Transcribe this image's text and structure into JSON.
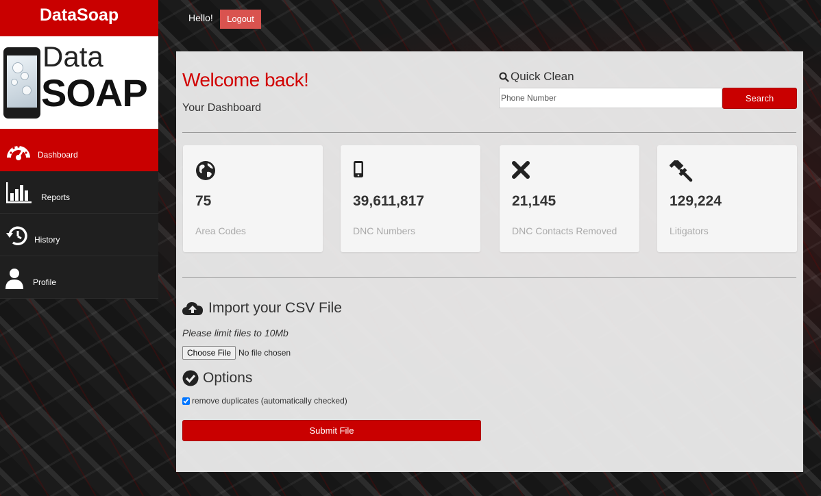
{
  "app": {
    "brand": "DataSoap",
    "logo_line1": "Data",
    "logo_line2": "SOAP",
    "accent_color": "#c90000"
  },
  "sidebar": {
    "items": [
      {
        "label": "Dashboard",
        "icon": "dashboard-gauge-icon",
        "active": true
      },
      {
        "label": "Reports",
        "icon": "bar-chart-icon",
        "active": false
      },
      {
        "label": "History",
        "icon": "history-icon",
        "active": false
      },
      {
        "label": "Profile",
        "icon": "user-icon",
        "active": false
      }
    ]
  },
  "topbar": {
    "greeting": "Hello!",
    "logout_label": "Logout"
  },
  "main": {
    "welcome": "Welcome back!",
    "subtitle": "Your Dashboard",
    "quick_clean": {
      "title": "Quick Clean",
      "placeholder": "Phone Number",
      "button_label": "Search"
    },
    "stats": [
      {
        "icon": "globe-icon",
        "value": "75",
        "label": "Area Codes"
      },
      {
        "icon": "mobile-phone-icon",
        "value": "39,611,817",
        "label": "DNC Numbers"
      },
      {
        "icon": "close-x-icon",
        "value": "21,145",
        "label": "DNC Contacts Removed"
      },
      {
        "icon": "gavel-icon",
        "value": "129,224",
        "label": "Litigators"
      }
    ],
    "import": {
      "title": "Import your CSV File",
      "limit_note": "Please limit files to 10Mb",
      "choose_file_label": "Choose File",
      "no_file_text": "No file chosen"
    },
    "options": {
      "title": "Options",
      "remove_duplicates_label": "remove duplicates (automatically checked)",
      "remove_duplicates_checked": true
    },
    "submit_label": "Submit File"
  }
}
